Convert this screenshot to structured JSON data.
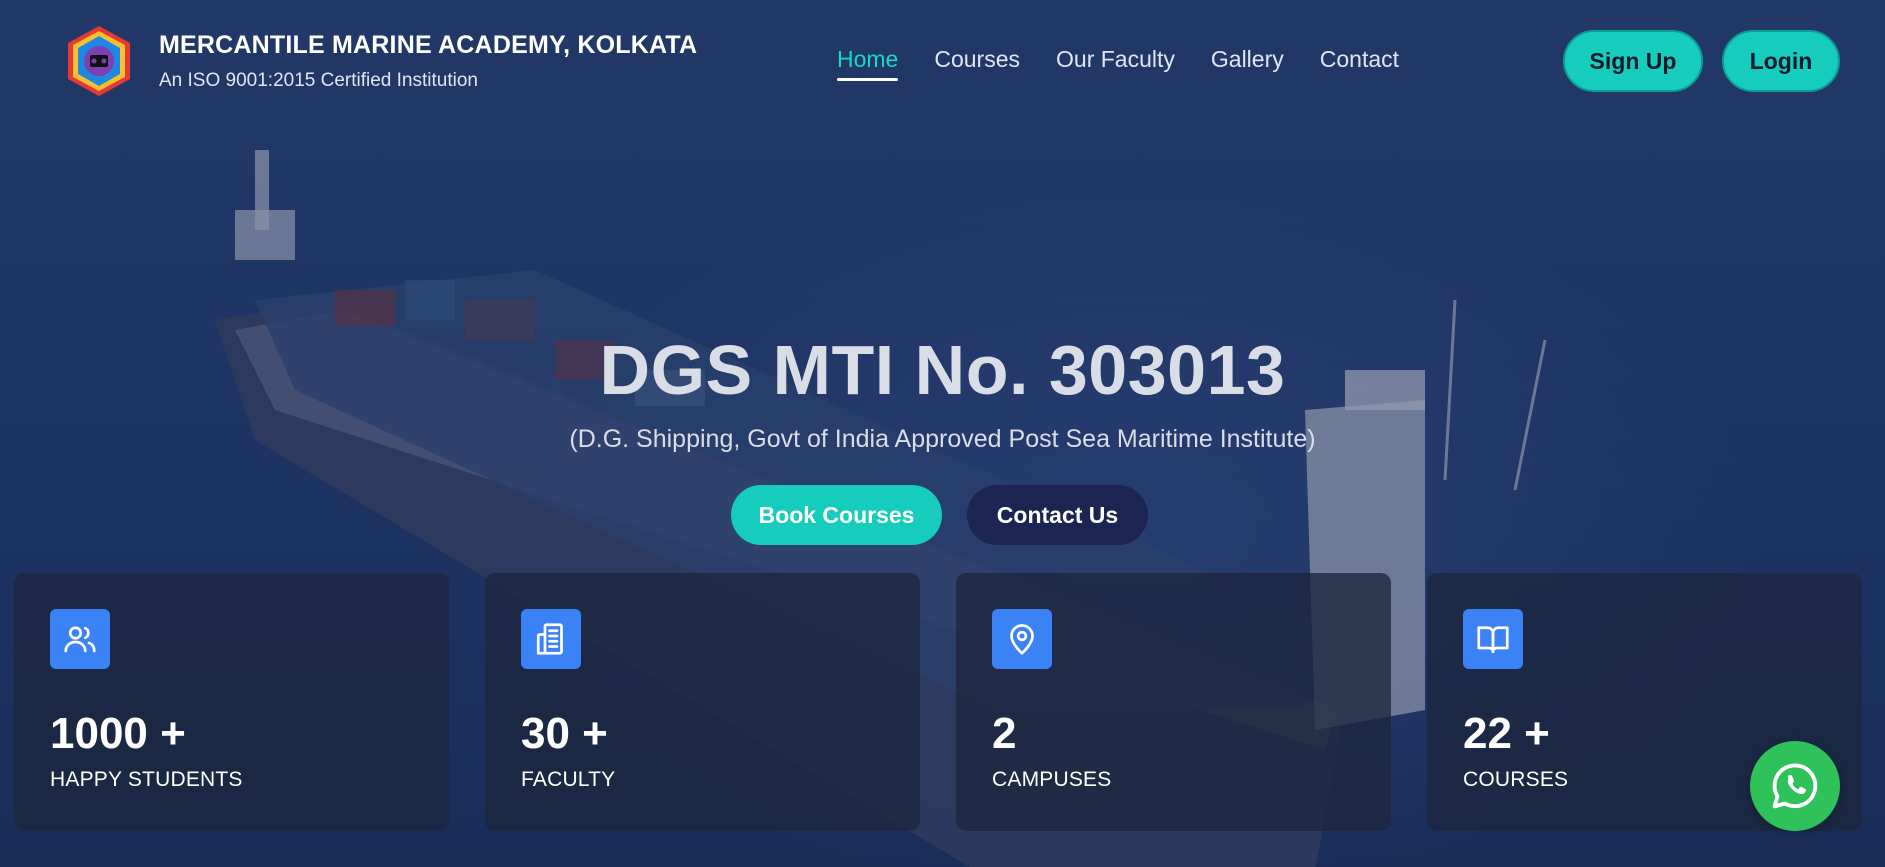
{
  "brand": {
    "title": "MERCANTILE MARINE ACADEMY, KOLKATA",
    "subtitle": "An ISO 9001:2015 Certified Institution",
    "logo_icon": "academy-logo"
  },
  "nav": {
    "items": [
      {
        "label": "Home",
        "active": true
      },
      {
        "label": "Courses",
        "active": false
      },
      {
        "label": "Our Faculty",
        "active": false
      },
      {
        "label": "Gallery",
        "active": false
      },
      {
        "label": "Contact",
        "active": false
      }
    ]
  },
  "auth": {
    "signup_label": "Sign Up",
    "login_label": "Login"
  },
  "hero": {
    "title": "DGS MTI No. 303013",
    "subtitle": "(D.G. Shipping, Govt of India Approved Post Sea Maritime Institute)",
    "primary_cta": "Book Courses",
    "secondary_cta": "Contact Us"
  },
  "stats": [
    {
      "icon": "users-icon",
      "value": "1000 +",
      "label": "HAPPY STUDENTS"
    },
    {
      "icon": "building-icon",
      "value": "30 +",
      "label": "FACULTY"
    },
    {
      "icon": "map-pin-icon",
      "value": "2",
      "label": "CAMPUSES"
    },
    {
      "icon": "book-open-icon",
      "value": "22 +",
      "label": "COURSES"
    }
  ],
  "floating": {
    "whatsapp_icon": "whatsapp-icon"
  },
  "colors": {
    "accent": "#16cdbd",
    "nav_active": "#1ad6c5",
    "secondary_button": "#1c2452",
    "stat_icon_bg": "#3b82f6",
    "whatsapp": "#2fc25b"
  }
}
